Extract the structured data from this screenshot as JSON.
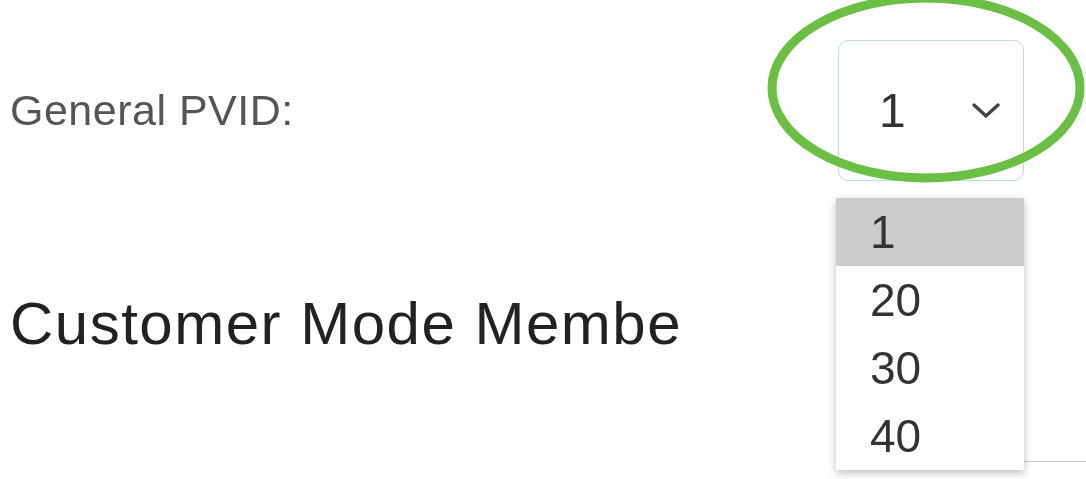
{
  "general_pvid": {
    "label": "General PVID:",
    "select": {
      "value": "1",
      "expanded": true,
      "options": [
        {
          "label": "1",
          "selected": true
        },
        {
          "label": "20",
          "selected": false
        },
        {
          "label": "30",
          "selected": false
        },
        {
          "label": "40",
          "selected": false
        }
      ]
    }
  },
  "section_heading": "Customer Mode Membe"
}
